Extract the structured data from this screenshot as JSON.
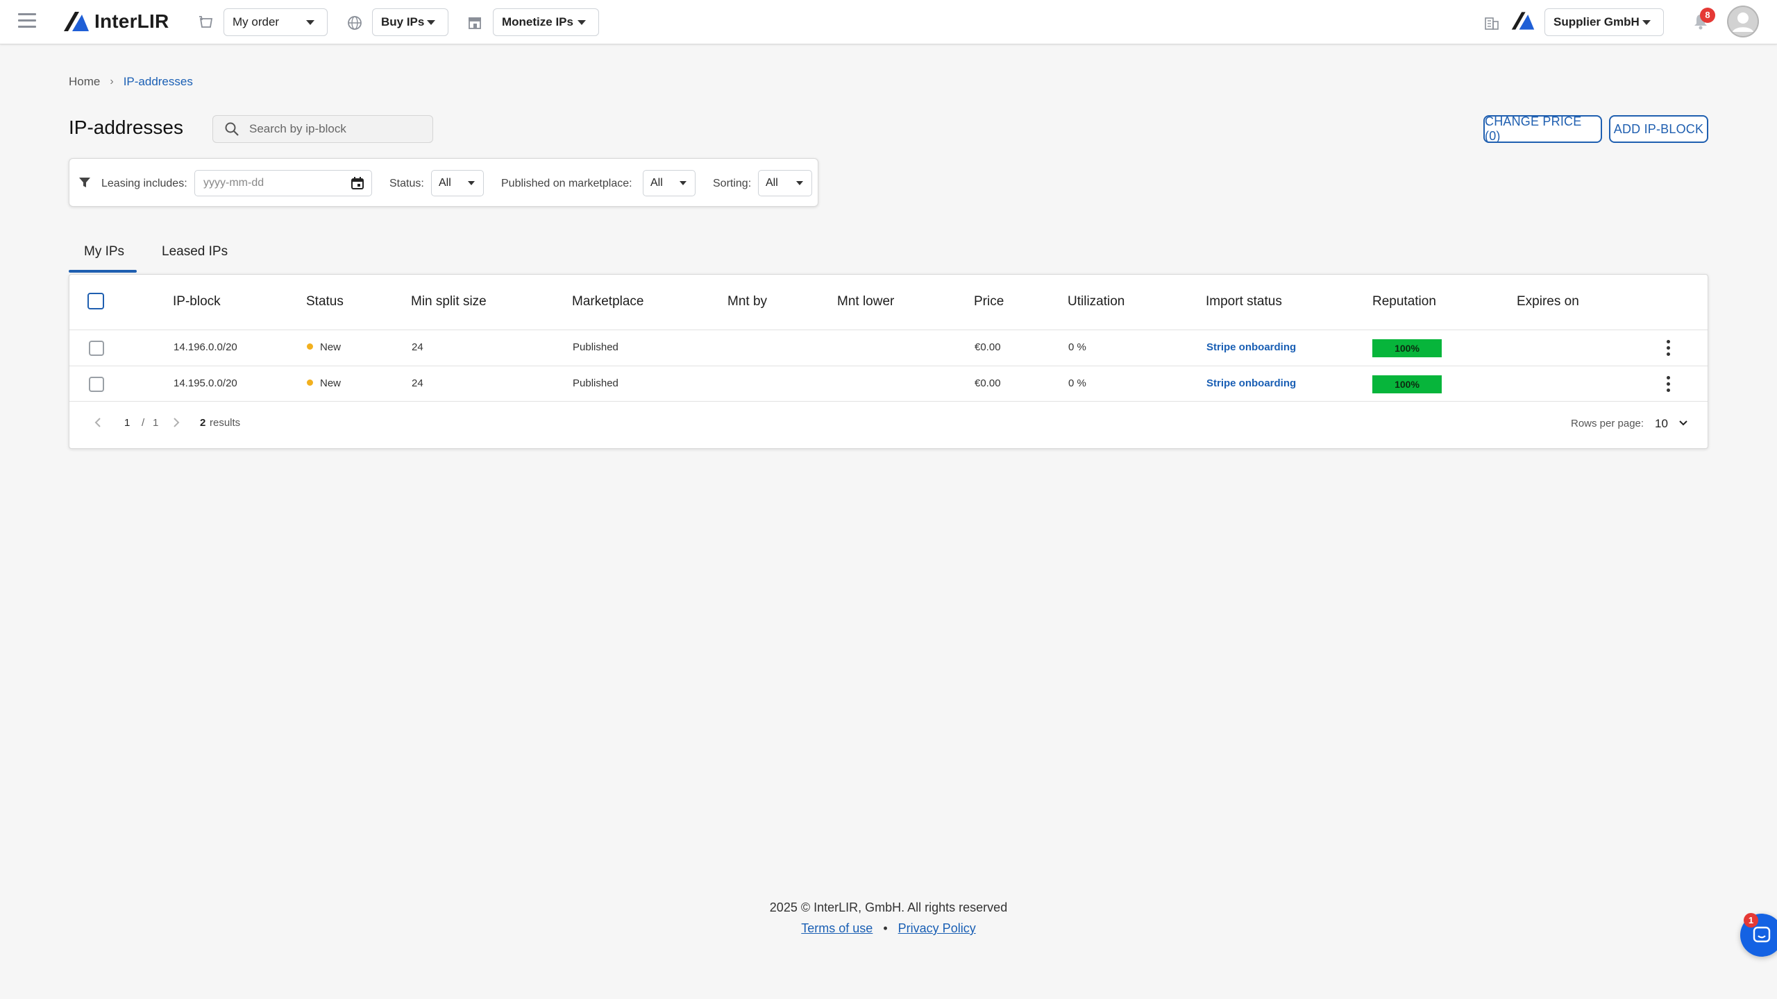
{
  "header": {
    "brand": "InterLIR",
    "order_select": "My order",
    "buy_select": "Buy IPs",
    "monetize_select": "Monetize IPs",
    "company_select": "Supplier GmbH",
    "notifications_count": "8"
  },
  "breadcrumb": {
    "home": "Home",
    "current": "IP-addresses"
  },
  "page": {
    "title": "IP-addresses",
    "search_placeholder": "Search by ip-block",
    "change_price_button": "CHANGE PRICE (0)",
    "add_block_button": "ADD IP-BLOCK"
  },
  "filters": {
    "leasing_label": "Leasing includes:",
    "date_placeholder": "yyyy-mm-dd",
    "status_label": "Status:",
    "status_value": "All",
    "marketplace_label": "Published on marketplace:",
    "marketplace_value": "All",
    "sorting_label": "Sorting:",
    "sorting_value": "All"
  },
  "tabs": [
    "My IPs",
    "Leased IPs"
  ],
  "table": {
    "columns": [
      "IP-block",
      "Status",
      "Min split size",
      "Marketplace",
      "Mnt by",
      "Mnt lower",
      "Price",
      "Utilization",
      "Import status",
      "Reputation",
      "Expires on"
    ],
    "rows": [
      {
        "ip_block": "14.196.0.0/20",
        "status": "New",
        "min_split": "24",
        "marketplace": "Published",
        "mnt_by": "",
        "mnt_lower": "",
        "price": "€0.00",
        "utilization": "0 %",
        "import_status": "Stripe onboarding",
        "reputation": "100%",
        "expires_on": ""
      },
      {
        "ip_block": "14.195.0.0/20",
        "status": "New",
        "min_split": "24",
        "marketplace": "Published",
        "mnt_by": "",
        "mnt_lower": "",
        "price": "€0.00",
        "utilization": "0 %",
        "import_status": "Stripe onboarding",
        "reputation": "100%",
        "expires_on": ""
      }
    ]
  },
  "pagination": {
    "current_page": "1",
    "separator": "/",
    "total_pages": "1",
    "results_count": "2",
    "results_label": "results",
    "rows_per_page_label": "Rows per page:",
    "rows_per_page_value": "10"
  },
  "footer": {
    "copyright": "2025 © InterLIR, GmbH. All rights reserved",
    "terms": "Terms of use",
    "bullet": "•",
    "privacy": "Privacy Policy",
    "chat_badge": "1"
  },
  "colors": {
    "accent": "#1f5fb0",
    "status_new": "#f2b01e",
    "reputation_good": "#07b53b",
    "badge": "#e53935"
  }
}
